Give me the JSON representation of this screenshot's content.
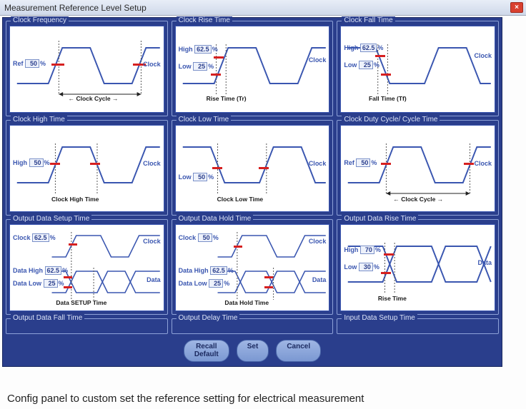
{
  "window": {
    "title": "Measurement Reference Level Setup",
    "close_glyph": "×"
  },
  "groups": {
    "r0c0": {
      "title": "Clock Frequency",
      "ref_label": "Ref",
      "ref_value": "50",
      "pct": "%",
      "sig": "Clock",
      "meas": "Clock Cycle"
    },
    "r0c1": {
      "title": "Clock Rise Time",
      "high_label": "High",
      "high_value": "62.5",
      "low_label": "Low",
      "low_value": "25",
      "pct": "%",
      "sig": "Clock",
      "meas": "Rise Time (Tr)"
    },
    "r0c2": {
      "title": "Clock Fall Time",
      "high_label": "High",
      "high_value": "62.5",
      "low_label": "Low",
      "low_value": "25",
      "pct": "%",
      "sig": "Clock",
      "meas": "Fall Time (Tf)"
    },
    "r1c0": {
      "title": "Clock High Time",
      "high_label": "High",
      "high_value": "50",
      "pct": "%",
      "sig": "Clock",
      "meas": "Clock High Time"
    },
    "r1c1": {
      "title": "Clock Low Time",
      "low_label": "Low",
      "low_value": "50",
      "pct": "%",
      "sig": "Clock",
      "meas": "Clock Low Time"
    },
    "r1c2": {
      "title": "Clock Duty Cycle/ Cycle Time",
      "ref_label": "Ref",
      "ref_value": "50",
      "pct": "%",
      "sig": "Clock",
      "meas": "Clock Cycle"
    },
    "r2c0": {
      "title": "Output Data Setup Time",
      "clk_label": "Clock",
      "clk_value": "62.5",
      "dh_label": "Data High",
      "dh_value": "62.5",
      "dl_label": "Data Low",
      "dl_value": "25",
      "pct": "%",
      "sig1": "Clock",
      "sig2": "Data",
      "meas": "Data SETUP Time"
    },
    "r2c1": {
      "title": "Output Data Hold Time",
      "clk_label": "Clock",
      "clk_value": "50",
      "dh_label": "Data High",
      "dh_value": "62.5",
      "dl_label": "Data Low",
      "dl_value": "25",
      "pct": "%",
      "sig1": "Clock",
      "sig2": "Data",
      "meas": "Data Hold Time"
    },
    "r2c2": {
      "title": "Output Data Rise Time",
      "high_label": "High",
      "high_value": "70",
      "low_label": "Low",
      "low_value": "30",
      "pct": "%",
      "sig": "Data",
      "meas": "Rise Time"
    },
    "r3c0": {
      "title": "Output Data Fall Time"
    },
    "r3c1": {
      "title": "Output Delay Time"
    },
    "r3c2": {
      "title": "Input Data Setup Time"
    }
  },
  "buttons": {
    "recall": "Recall\nDefault",
    "set": "Set",
    "cancel": "Cancel"
  },
  "caption": "Config panel to custom set the reference setting for electrical measurement"
}
